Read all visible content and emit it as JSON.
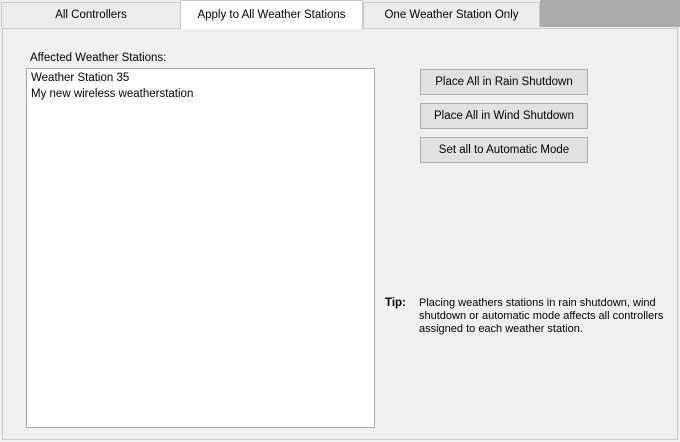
{
  "tabs": [
    {
      "label": "All Controllers",
      "selected": false
    },
    {
      "label": "Apply to All Weather Stations",
      "selected": true
    },
    {
      "label": "One Weather Station Only",
      "selected": false
    }
  ],
  "affected": {
    "label": "Affected Weather Stations:",
    "items": [
      "Weather Station 35",
      "My new wireless weatherstation"
    ]
  },
  "actions": {
    "rain_shutdown": "Place All in Rain Shutdown",
    "wind_shutdown": "Place All in Wind Shutdown",
    "automatic_mode": "Set all to Automatic Mode"
  },
  "tip": {
    "label": "Tip:",
    "text": "Placing weathers stations in rain shutdown, wind shutdown or automatic mode affects all controllers assigned to each weather station."
  }
}
